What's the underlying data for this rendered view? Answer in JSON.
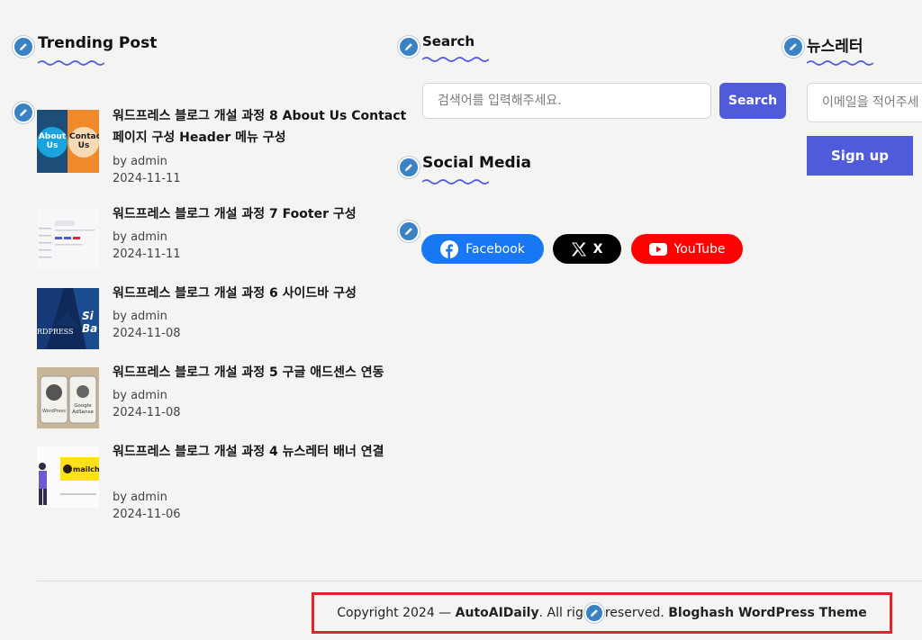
{
  "trending": {
    "title": "Trending Post",
    "posts": [
      {
        "title": "워드프레스 블로그 개설 과정 8 About Us Contact 페이지 구성 Header 메뉴 구성",
        "author": "by admin",
        "date": "2024-11-11",
        "thumb_text_1": "About Us",
        "thumb_text_2": "Contact Us"
      },
      {
        "title": "워드프레스 블로그 개설 과정 7 Footer 구성",
        "author": "by admin",
        "date": "2024-11-11"
      },
      {
        "title": "워드프레스 블로그 개설 과정 6 사이드바 구성",
        "author": "by admin",
        "date": "2024-11-08",
        "thumb_text_1": "RDPRESS",
        "thumb_text_2": "Si Ba"
      },
      {
        "title": "워드프레스 블로그 개설 과정 5 구글 애드센스 연동",
        "author": "by admin",
        "date": "2024-11-08",
        "thumb_text_1": "WordPress",
        "thumb_text_2": "Google AdSense"
      },
      {
        "title": "워드프레스 블로그 개설 과정 4 뉴스레터 배너 연결",
        "author": "by admin",
        "date": "2024-11-06",
        "thumb_text_1": "mailch"
      }
    ]
  },
  "search": {
    "title": "Search",
    "placeholder": "검색어를 입력해주세요.",
    "button": "Search"
  },
  "social": {
    "title": "Social Media",
    "buttons": [
      {
        "label": "Facebook",
        "color": "#1877f2"
      },
      {
        "label": "X",
        "color": "#000000"
      },
      {
        "label": "YouTube",
        "color": "#ff0000"
      }
    ]
  },
  "newsletter": {
    "title": "뉴스레터",
    "placeholder": "이메일을 적어주세요",
    "button": "Sign up"
  },
  "footer": {
    "copyright_prefix": "Copyright 2024 — ",
    "site_name": "AutoAIDaily",
    "rights_a": ". All rig",
    "rights_b": "reserved. ",
    "theme": "Bloghash WordPress Theme"
  },
  "colors": {
    "accent": "#4f5bdb",
    "highlight_border": "#e0252c",
    "edit_pin": "#3b82c4"
  }
}
